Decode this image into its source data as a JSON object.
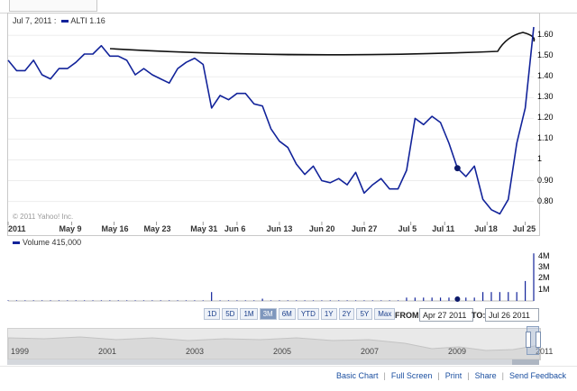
{
  "legend": {
    "date": "Jul 7, 2011 :",
    "symbol": "ALTI",
    "value": "1.16"
  },
  "volume_legend": {
    "label": "Volume",
    "value": "415,000"
  },
  "copyright": "© 2011 Yahoo! Inc.",
  "chart_data": {
    "type": "line",
    "series": [
      {
        "name": "ALTI",
        "color": "#12239a"
      }
    ],
    "x_tick_labels": [
      "2011",
      "May 9",
      "May 16",
      "May 23",
      "May 31",
      "Jun 6",
      "Jun 13",
      "Jun 20",
      "Jun 27",
      "Jul 5",
      "Jul 11",
      "Jul 18",
      "Jul 25"
    ],
    "y_tick_labels": [
      "0.80",
      "0.90",
      "1",
      "1.10",
      "1.20",
      "1.30",
      "1.40",
      "1.50",
      "1.60"
    ],
    "ylim": [
      0.72,
      1.64
    ],
    "price_ticks": [
      0.8,
      0.9,
      1.0,
      1.1,
      1.2,
      1.3,
      1.4,
      1.5,
      1.6
    ],
    "close": [
      1.48,
      1.43,
      1.43,
      1.48,
      1.41,
      1.39,
      1.44,
      1.44,
      1.47,
      1.51,
      1.51,
      1.55,
      1.5,
      1.5,
      1.48,
      1.41,
      1.44,
      1.41,
      1.39,
      1.37,
      1.44,
      1.47,
      1.49,
      1.46,
      1.25,
      1.31,
      1.29,
      1.32,
      1.32,
      1.27,
      1.26,
      1.15,
      1.09,
      1.06,
      0.98,
      0.93,
      0.97,
      0.9,
      0.89,
      0.91,
      0.88,
      0.94,
      0.84,
      0.88,
      0.91,
      0.86,
      0.86,
      0.95,
      1.2,
      1.17,
      1.21,
      1.18,
      1.08,
      0.96,
      0.92,
      0.97,
      0.81,
      0.76,
      0.74,
      0.81,
      1.08,
      1.25,
      1.64
    ],
    "marker_index": 53,
    "volume_ticks": [
      "1M",
      "2M",
      "3M",
      "4M"
    ],
    "volume_ylim": [
      0,
      4.4
    ],
    "volume_millions": [
      0.05,
      0.05,
      0.05,
      0.05,
      0.05,
      0.05,
      0.05,
      0.05,
      0.05,
      0.05,
      0.05,
      0.05,
      0.05,
      0.05,
      0.05,
      0.05,
      0.05,
      0.05,
      0.05,
      0.05,
      0.05,
      0.05,
      0.05,
      0.05,
      0.8,
      0.05,
      0.05,
      0.05,
      0.05,
      0.05,
      0.2,
      0.05,
      0.05,
      0.05,
      0.05,
      0.05,
      0.05,
      0.05,
      0.05,
      0.05,
      0.05,
      0.05,
      0.05,
      0.05,
      0.05,
      0.05,
      0.05,
      0.3,
      0.3,
      0.3,
      0.3,
      0.3,
      0.3,
      0.3,
      0.3,
      0.3,
      0.8,
      0.8,
      0.8,
      0.8,
      0.8,
      1.8,
      4.3
    ]
  },
  "range_buttons": [
    "1D",
    "5D",
    "1M",
    "3M",
    "6M",
    "YTD",
    "1Y",
    "2Y",
    "5Y",
    "Max"
  ],
  "active_range": "3M",
  "date_range": {
    "from_label": "FROM:",
    "from_value": "Apr 27 2011",
    "to_label": "TO:",
    "to_value": "Jul 26 2011"
  },
  "navigator_years": [
    "1999",
    "2001",
    "2003",
    "2005",
    "2007",
    "2009",
    "2011"
  ],
  "footer_links": [
    "Basic Chart",
    "Full Screen",
    "Print",
    "Share",
    "Send Feedback"
  ]
}
